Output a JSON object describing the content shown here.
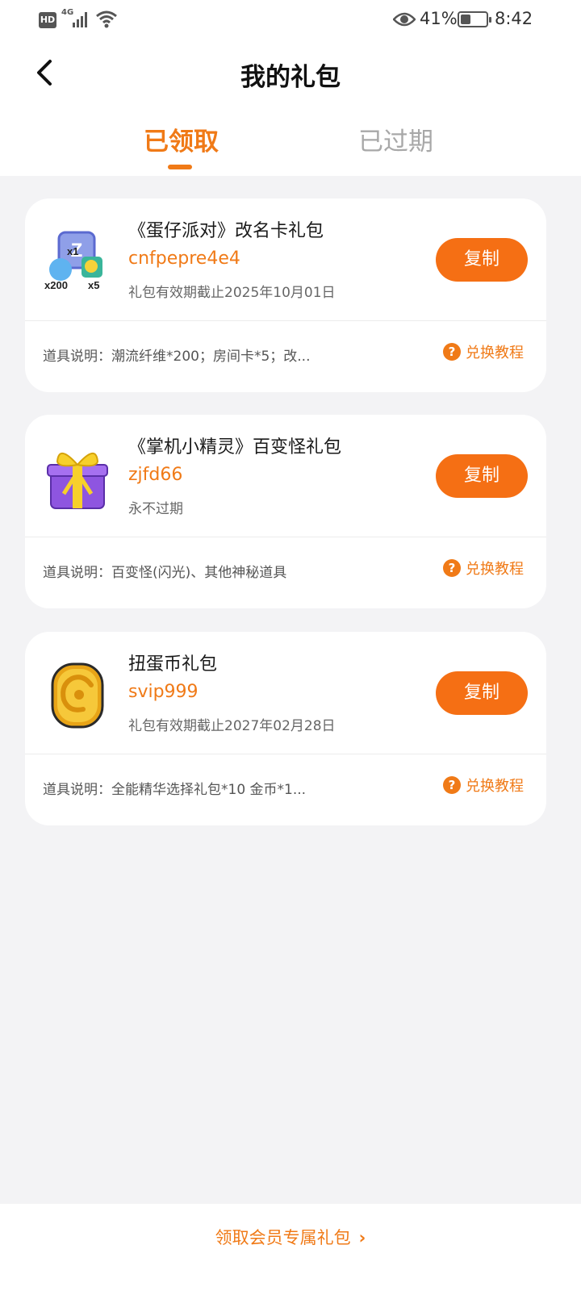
{
  "status_bar": {
    "hd": "HD",
    "network": "4G",
    "battery_percent": "41%",
    "battery_level": 0.41,
    "time": "8:42"
  },
  "header": {
    "title": "我的礼包",
    "back_icon": "chevron-left-icon"
  },
  "tabs": [
    {
      "label": "已领取",
      "active": true
    },
    {
      "label": "已过期",
      "active": false
    }
  ],
  "gifts": [
    {
      "name": "《蛋仔派对》改名卡礼包",
      "code": "cnfpepre4e4",
      "expiry": "礼包有效期截止2025年10月01日",
      "description": "道具说明：潮流纤维*200；房间卡*5；改...",
      "copy_label": "复制",
      "tutorial_label": "兑换教程",
      "thumb_icon": "rename-card-icon",
      "thumb_badges": [
        "x1",
        "x200",
        "x5"
      ]
    },
    {
      "name": "《掌机小精灵》百变怪礼包",
      "code": "zjfd66",
      "expiry": "永不过期",
      "description": "道具说明：百变怪(闪光)、其他神秘道具",
      "copy_label": "复制",
      "tutorial_label": "兑换教程",
      "thumb_icon": "gift-box-icon"
    },
    {
      "name": "扭蛋币礼包",
      "code": "svip999",
      "expiry": "礼包有效期截止2027年02月28日",
      "description": "道具说明：全能精华选择礼包*10 金币*1...",
      "copy_label": "复制",
      "tutorial_label": "兑换教程",
      "thumb_icon": "gold-coin-icon"
    }
  ],
  "bottom": {
    "member_link": "领取会员专属礼包"
  },
  "colors": {
    "accent": "#f07a17",
    "button": "#f56f14",
    "background": "#f3f3f5"
  }
}
